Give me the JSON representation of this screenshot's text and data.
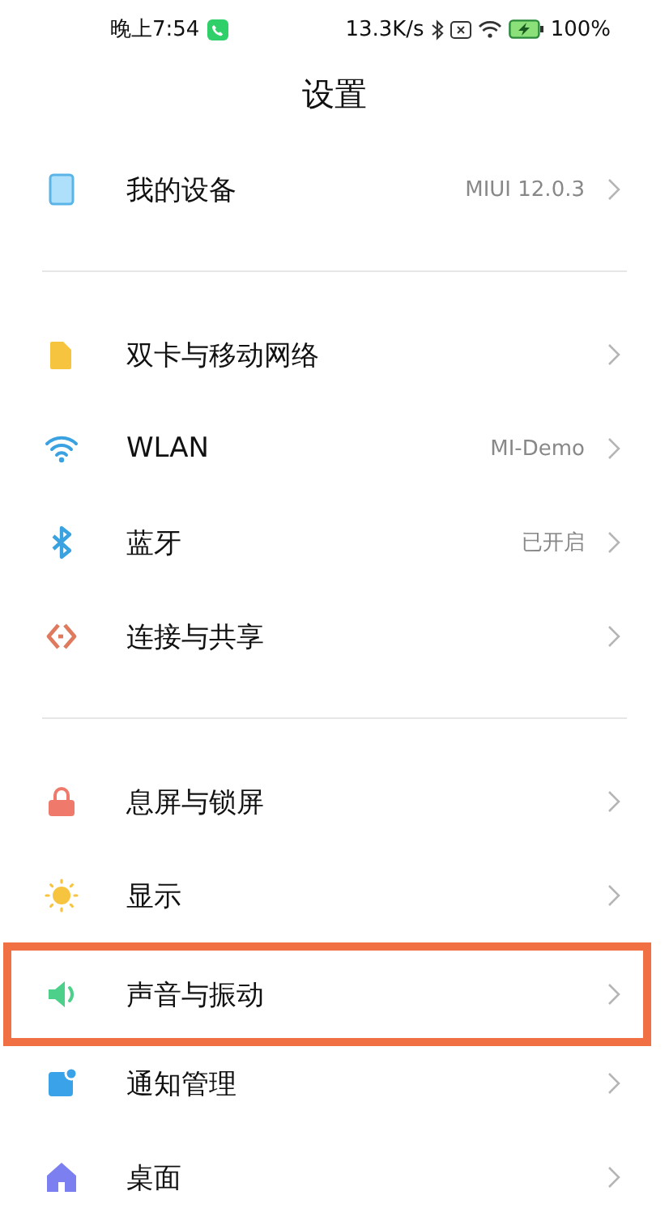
{
  "status_bar": {
    "time": "晚上7:54",
    "speed": "13.3K/s",
    "battery": "100%"
  },
  "title": "设置",
  "groups": [
    {
      "items": [
        {
          "kind": "device",
          "label": "我的设备",
          "value": "MIUI 12.0.3",
          "highlighted": false
        }
      ]
    },
    {
      "items": [
        {
          "kind": "sim",
          "label": "双卡与移动网络",
          "highlighted": false
        },
        {
          "kind": "wifi",
          "label": "WLAN",
          "value": "MI-Demo",
          "highlighted": false
        },
        {
          "kind": "bluetooth",
          "label": "蓝牙",
          "value": "已开启",
          "highlighted": false
        },
        {
          "kind": "share",
          "label": "连接与共享",
          "highlighted": false
        }
      ]
    },
    {
      "items": [
        {
          "kind": "lock",
          "label": "息屏与锁屏",
          "highlighted": false
        },
        {
          "kind": "sun",
          "label": "显示",
          "highlighted": false
        },
        {
          "kind": "speaker",
          "label": "声音与振动",
          "highlighted": true
        },
        {
          "kind": "notification",
          "label": "通知管理",
          "highlighted": false
        },
        {
          "kind": "home",
          "label": "桌面",
          "highlighted": false
        }
      ]
    }
  ]
}
